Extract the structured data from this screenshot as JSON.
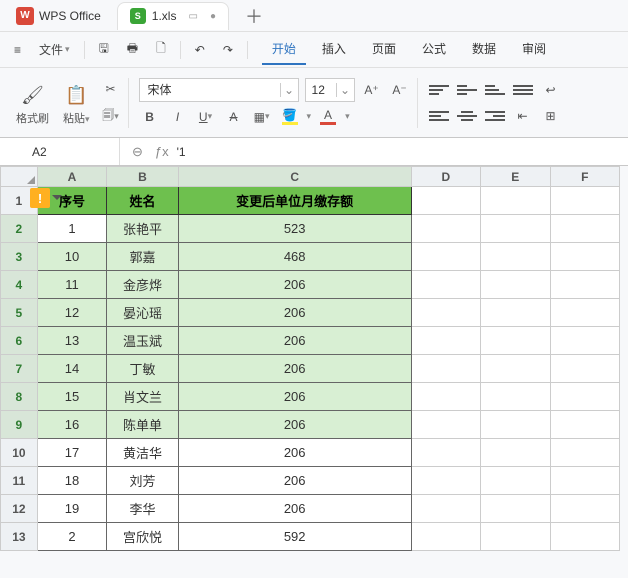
{
  "title": {
    "app": "WPS Office",
    "file": "1.xls"
  },
  "menubar": {
    "file": "文件",
    "tabs": [
      "开始",
      "插入",
      "页面",
      "公式",
      "数据",
      "审阅"
    ],
    "active": "开始"
  },
  "ribbon": {
    "format_painter": "格式刷",
    "paste": "粘贴",
    "font_name": "宋体",
    "font_size": "12"
  },
  "fbar": {
    "name": "A2",
    "fx": "ƒx",
    "value": "'1"
  },
  "columns": [
    "A",
    "B",
    "C",
    "D",
    "E",
    "F"
  ],
  "headers": {
    "a": "序号",
    "b": "姓名",
    "c": "变更后单位月缴存额"
  },
  "rows": [
    {
      "n": "1",
      "a": "1",
      "b": "张艳平",
      "c": "523"
    },
    {
      "n": "2",
      "a": "10",
      "b": "郭嘉",
      "c": "468"
    },
    {
      "n": "3",
      "a": "11",
      "b": "金彦烨",
      "c": "206"
    },
    {
      "n": "4",
      "a": "12",
      "b": "晏沁瑶",
      "c": "206"
    },
    {
      "n": "5",
      "a": "13",
      "b": "温玉斌",
      "c": "206"
    },
    {
      "n": "6",
      "a": "14",
      "b": "丁敏",
      "c": "206"
    },
    {
      "n": "7",
      "a": "15",
      "b": "肖文兰",
      "c": "206"
    },
    {
      "n": "8",
      "a": "16",
      "b": "陈单单",
      "c": "206"
    },
    {
      "n": "9",
      "a": "17",
      "b": "黄洁华",
      "c": "206"
    },
    {
      "n": "10",
      "a": "18",
      "b": "刘芳",
      "c": "206"
    },
    {
      "n": "11",
      "a": "19",
      "b": "李华",
      "c": "206"
    },
    {
      "n": "12",
      "a": "2",
      "b": "宫欣悦",
      "c": "592"
    }
  ],
  "selection": {
    "from_row": 1,
    "to_row": 8
  }
}
